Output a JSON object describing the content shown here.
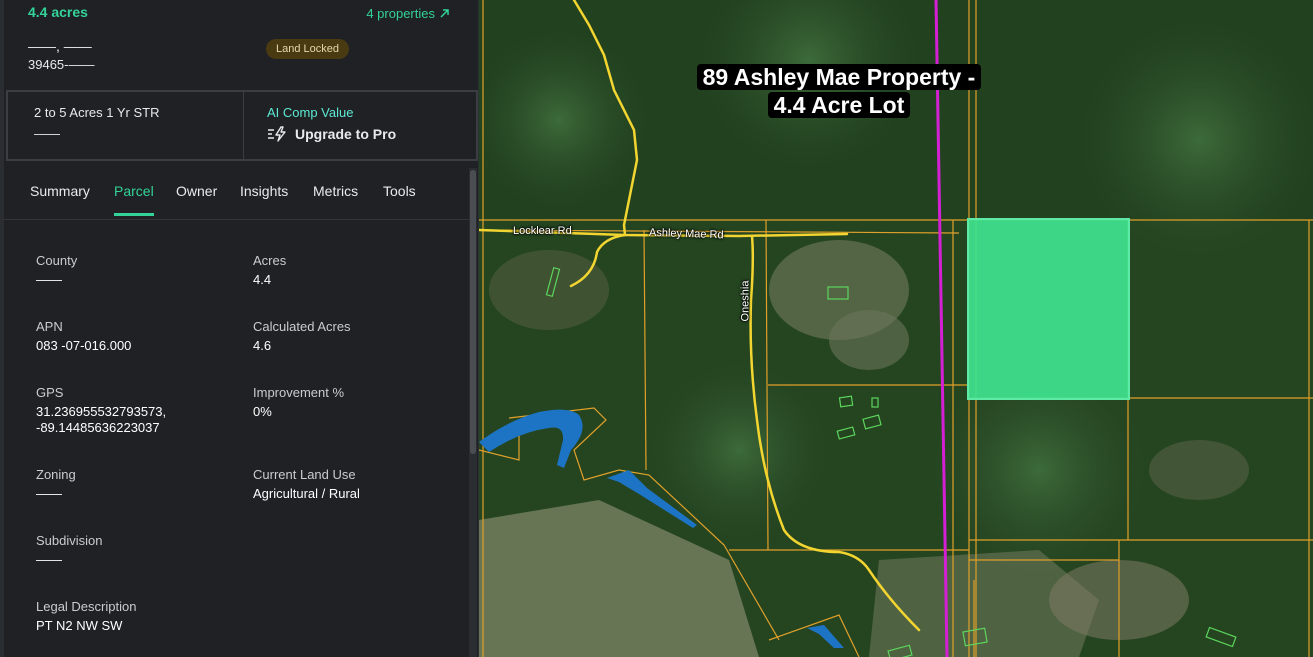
{
  "header": {
    "acres": "4.4 acres",
    "properties_link": "4 properties",
    "address_line1": "——, ——",
    "address_line2": "39465-——",
    "badge": "Land Locked"
  },
  "cards": {
    "str_label": "2 to 5 Acres 1 Yr STR",
    "str_value": "——",
    "ai_label": "AI Comp Value",
    "upgrade_label": "Upgrade to Pro"
  },
  "tabs": [
    "Summary",
    "Parcel",
    "Owner",
    "Insights",
    "Metrics",
    "Tools"
  ],
  "active_tab": "Parcel",
  "fields": {
    "county": {
      "label": "County",
      "value": "——"
    },
    "acres": {
      "label": "Acres",
      "value": "4.4"
    },
    "apn": {
      "label": "APN",
      "value": "083 -07-016.000"
    },
    "calc_acres": {
      "label": "Calculated Acres",
      "value": "4.6"
    },
    "gps": {
      "label": "GPS",
      "value_line1": "31.236955532793573,",
      "value_line2": "-89.14485636223037"
    },
    "improvement": {
      "label": "Improvement %",
      "value": "0%"
    },
    "zoning": {
      "label": "Zoning",
      "value": "——"
    },
    "land_use": {
      "label": "Current Land Use",
      "value": "Agricultural / Rural"
    },
    "subdivision": {
      "label": "Subdivision",
      "value": "——"
    },
    "legal": {
      "label": "Legal Description",
      "value": "PT N2 NW SW"
    }
  },
  "map": {
    "title_line1": "89 Ashley Mae Property -",
    "title_line2": "4.4 Acre Lot",
    "roads": {
      "locklear": "Locklear Rd",
      "ashley": "Ashley Mae Rd",
      "oneshia": "Oneshia"
    },
    "colors": {
      "highlight": "#3ee38f",
      "parcel_line": "#e0a02a",
      "road": "#f2d530",
      "power_line": "#d41fd4",
      "water": "#1d74c4",
      "building": "#5cd65c"
    }
  }
}
